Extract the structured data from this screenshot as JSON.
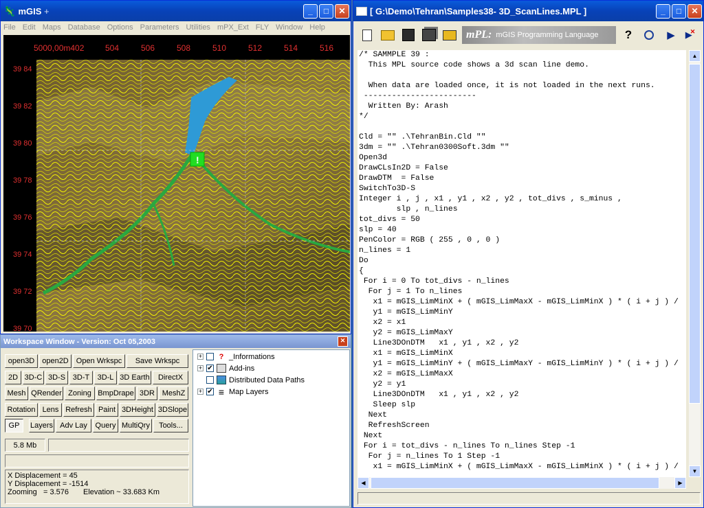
{
  "mgis": {
    "title": "mGIS",
    "title_suffix": "+",
    "menu": [
      "File",
      "Edit",
      "Maps",
      "Database",
      "Options",
      "Parameters",
      "Utilities",
      "mPX_Ext",
      "FLY",
      "Window",
      "Help"
    ],
    "top_ruler": [
      "5000,00m402",
      "504",
      "506",
      "508",
      "510",
      "512",
      "514",
      "516"
    ],
    "left_ruler": [
      "39 84",
      "39 82",
      "39 80",
      "39 78",
      "39 76",
      "39 74",
      "39 72",
      "39 70"
    ]
  },
  "workspace": {
    "title": "Workspace Window - Version: Oct 05,2003",
    "buttons": [
      [
        "open3D",
        "open2D",
        "Open Wrkspc",
        "Save Wrkspc"
      ],
      [
        "2D",
        "3D-C",
        "3D-S",
        "3D-T",
        "3D-L",
        "3D Earth",
        "DirectX"
      ],
      [
        "Mesh",
        "QRender",
        "Zoning",
        "BmpDrape",
        "3DR",
        "MeshZ"
      ],
      [
        "Rotation",
        "Lens",
        "Refresh",
        "Paint",
        "3DHeight",
        "3DSlope"
      ],
      [
        "GP",
        "Layers",
        "Adv Lay",
        "Query",
        "MultiQry",
        "Tools..."
      ]
    ],
    "memory": "5.8 Mb",
    "tree": [
      {
        "label": "_Informations",
        "checked": false,
        "expand": true,
        "icon": "question-icon"
      },
      {
        "label": "Add-ins",
        "checked": true,
        "expand": true,
        "icon": "addins-icon"
      },
      {
        "label": "Distributed Data Paths",
        "checked": false,
        "expand": false,
        "icon": "network-icon"
      },
      {
        "label": "Map Layers",
        "checked": true,
        "expand": true,
        "icon": "layers-icon"
      }
    ],
    "status": {
      "x_disp": "X Displacement = 45",
      "y_disp": "Y Displacement = -1514",
      "zoom": "Zooming   = 3.576",
      "elev": "Elevation ~ 33.683 Km"
    }
  },
  "editor": {
    "title": "[ G:\\Demo\\Tehran\\Samples38- 3D_ScanLines.MPL ]",
    "banner": "mPL:",
    "banner_sub": "mGIS Programming Language",
    "code": [
      "/* SAMMPLE 39 :",
      "  This MPL source code shows a 3d scan line demo.",
      "",
      "  When data are loaded once, it is not loaded in the next runs.",
      " ------------------------",
      "  Written By: Arash",
      "*/",
      "",
      "Cld = \"\" .\\TehranBin.Cld \"\"",
      "3dm = \"\" .\\Tehran0300Soft.3dm \"\"",
      "Open3d",
      "DrawCLsIn2D = False",
      "DrawDTM  = False",
      "SwitchTo3D-S",
      "Integer i , j , x1 , y1 , x2 , y2 , tot_divs , s_minus ,",
      "        slp , n_lines",
      "tot_divs = 50",
      "slp = 40",
      "PenColor = RGB ( 255 , 0 , 0 )",
      "n_lines = 1",
      "Do",
      "{",
      " For i = 0 To tot_divs - n_lines",
      "  For j = 1 To n_lines",
      "   x1 = mGIS_LimMinX + ( mGIS_LimMaxX - mGIS_LimMinX ) * ( i + j ) /",
      "   y1 = mGIS_LimMinY",
      "   x2 = x1",
      "   y2 = mGIS_LimMaxY",
      "   Line3DOnDTM   x1 , y1 , x2 , y2",
      "   x1 = mGIS_LimMinX",
      "   y1 = mGIS_LimMinY + ( mGIS_LimMaxY - mGIS_LimMinY ) * ( i + j ) /",
      "   x2 = mGIS_LimMaxX",
      "   y2 = y1",
      "   Line3DOnDTM   x1 , y1 , x2 , y2",
      "   Sleep slp",
      "  Next",
      "  RefreshScreen",
      " Next",
      " For i = tot_divs - n_lines To n_lines Step -1",
      "  For j = n_lines To 1 Step -1",
      "   x1 = mGIS_LimMinX + ( mGIS_LimMaxX - mGIS_LimMinX ) * ( i + j ) /"
    ]
  }
}
